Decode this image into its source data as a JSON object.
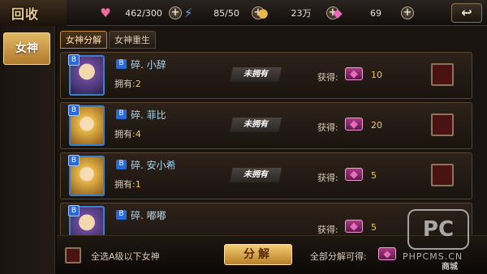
{
  "header": {
    "logo_text": "回收",
    "hearts": "462/300",
    "energy": "85/50",
    "coins": "23万",
    "gems": "69",
    "back_icon": "return-arrow-icon"
  },
  "sidebar": {
    "tab_label": "女神"
  },
  "tabs": [
    "女神分解",
    "女神重生"
  ],
  "cards": [
    {
      "name": "碎. 小辞",
      "owned_label": "拥有:",
      "owned": "2",
      "status": "未拥有",
      "gain_label": "获得:",
      "gain": "10",
      "portrait": "purple"
    },
    {
      "name": "碎. 菲比",
      "owned_label": "拥有:",
      "owned": "4",
      "status": "未拥有",
      "gain_label": "获得:",
      "gain": "20",
      "portrait": "blonde"
    },
    {
      "name": "碎. 安小希",
      "owned_label": "拥有:",
      "owned": "1",
      "status": "未拥有",
      "gain_label": "获得:",
      "gain": "5",
      "portrait": "blonde"
    },
    {
      "name": "碎. 嘟嘟",
      "owned_label": "拥有:",
      "owned": "",
      "status": "",
      "gain_label": "获得:",
      "gain": "5",
      "portrait": "purple"
    }
  ],
  "bottom": {
    "select_all_label": "全选A级以下女神",
    "decompose_label": "分解",
    "total_label": "全部分解可得:"
  },
  "watermark": {
    "brand": "PC",
    "site": "PHPCMS.CN",
    "shop": "商城"
  },
  "colors": {
    "accent": "#e2b864",
    "name": "#a6d8f4",
    "value": "#f0c85a",
    "gem": "#e86ab8"
  }
}
